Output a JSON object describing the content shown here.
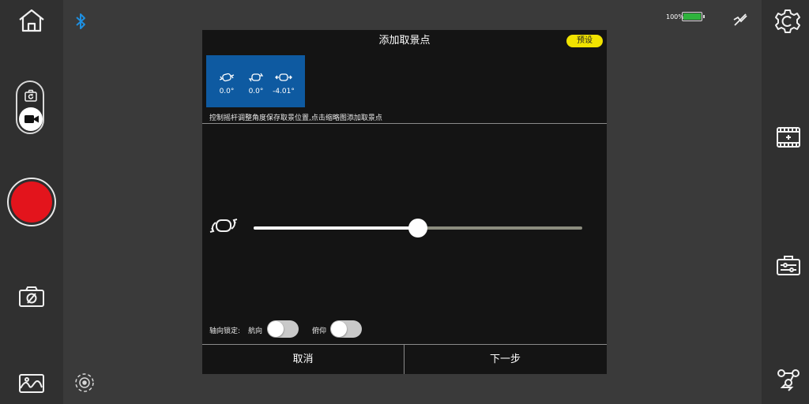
{
  "status": {
    "battery_percent": "100%",
    "battery_level": 0.95
  },
  "dialog": {
    "title": "添加取景点",
    "preset_label": "预设",
    "thumbnail": {
      "pan_value": "0.0°",
      "tilt_value": "0.0°",
      "roll_value": "-4.01°"
    },
    "hint": "控制摇杆调整角度保存取景位置,点击缩略图添加取景点",
    "slider": {
      "position": 0.5
    },
    "lock": {
      "label": "轴向锁定:",
      "heading_label": "航向",
      "heading_on": false,
      "pitch_label": "俯仰",
      "pitch_on": false
    },
    "cancel_label": "取消",
    "next_label": "下一步"
  },
  "colors": {
    "accent_yellow": "#f1e300",
    "record_red": "#e3141c",
    "thumb_blue": "#0e5aa1",
    "bluetooth_blue": "#1e8fe0",
    "battery_green": "#2fb33d"
  },
  "icons": [
    "home-icon",
    "bluetooth-icon",
    "camera-switch-icon",
    "video-icon",
    "record-icon",
    "screenshot-icon",
    "gallery-icon",
    "target-icon",
    "gesture-disabled-icon",
    "settings-icon",
    "timelapse-icon",
    "toolbox-icon",
    "path-icon"
  ]
}
